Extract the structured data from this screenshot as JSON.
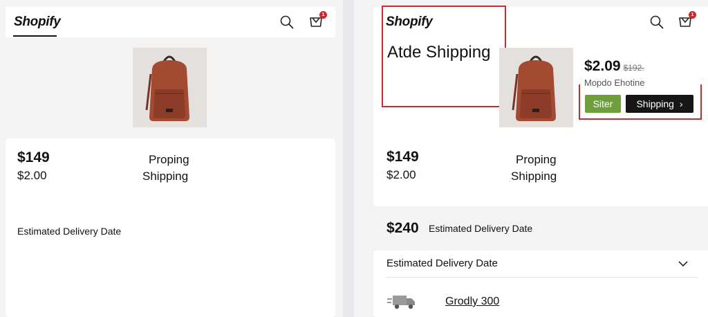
{
  "left": {
    "logo": "Shopify",
    "cart_badge": "1",
    "price": "$149",
    "subprice": "$2.00",
    "label_1": "Proping",
    "label_2": "Shipping",
    "delivery_label": "Estimated Delivery Date"
  },
  "right": {
    "logo": "Shopify",
    "cart_badge": "1",
    "highlight_title": "Atde Shipping",
    "offer_price": "$2.09",
    "offer_old_price": "$192.",
    "offer_subtitle": "Mopdo Ehotine",
    "green_button": "Siter",
    "dark_button": "Shipping",
    "price": "$149",
    "subprice": "$2.00",
    "label_1": "Proping",
    "label_2": "Shipping",
    "total": "$240",
    "total_label": "Estimated Delivery Date",
    "delivery_label": "Estimated Delivery Date",
    "shipping_option": "Grodly 300"
  },
  "colors": {
    "accent_red": "#cc2b2b",
    "green_button": "#6f9e3c",
    "dark_button": "#161616",
    "badge": "#d3252a"
  },
  "icons": [
    "search-icon",
    "cart-icon",
    "chevron-down-icon",
    "truck-icon",
    "chevron-right-icon"
  ]
}
